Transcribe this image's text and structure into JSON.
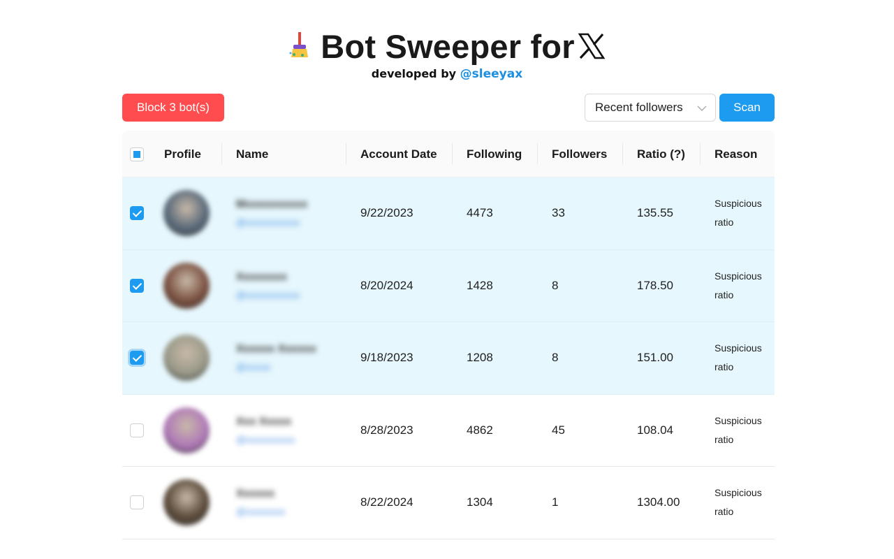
{
  "header": {
    "title": "Bot Sweeper for",
    "subtitle_prefix": "developed by",
    "subtitle_handle": "@sleeyax",
    "broom_icon": "broom-icon",
    "x_logo": "x-logo-icon"
  },
  "toolbar": {
    "block_label": "Block 3 bot(s)",
    "select_value": "Recent followers",
    "scan_label": "Scan",
    "colors": {
      "block": "#ff4d4f",
      "scan": "#1d9bf0"
    }
  },
  "table": {
    "columns": [
      "Profile",
      "Name",
      "Account Date",
      "Following",
      "Followers",
      "Ratio (?)",
      "Reason"
    ],
    "rows": [
      {
        "selected": true,
        "focus": false,
        "name": "Mxxxxxxxxxx",
        "handle": "@xxxxxxxxxxx",
        "avatar": "#5a6a7a",
        "date": "9/22/2023",
        "following": "4473",
        "followers": "33",
        "ratio": "135.55",
        "reason": "Suspicious ratio"
      },
      {
        "selected": true,
        "focus": false,
        "name": "Xxxxxxxx",
        "handle": "@xxxxxxxxxxx",
        "avatar": "#7a5040",
        "date": "8/20/2024",
        "following": "1428",
        "followers": "8",
        "ratio": "178.50",
        "reason": "Suspicious ratio"
      },
      {
        "selected": true,
        "focus": true,
        "name": "Xxxxxx Xxxxxx",
        "handle": "@xxxxx",
        "avatar": "#9a9a8a",
        "date": "9/18/2023",
        "following": "1208",
        "followers": "8",
        "ratio": "151.00",
        "reason": "Suspicious ratio"
      },
      {
        "selected": false,
        "focus": false,
        "name": "Xxx Xxxxx",
        "handle": "@xxxxxxxxxx",
        "avatar": "#b07ab8",
        "date": "8/28/2023",
        "following": "4862",
        "followers": "45",
        "ratio": "108.04",
        "reason": "Suspicious ratio"
      },
      {
        "selected": false,
        "focus": false,
        "name": "Xxxxxx",
        "handle": "@xxxxxxxx",
        "avatar": "#5a4a3a",
        "date": "8/22/2024",
        "following": "1304",
        "followers": "1",
        "ratio": "1304.00",
        "reason": "Suspicious ratio"
      }
    ]
  }
}
